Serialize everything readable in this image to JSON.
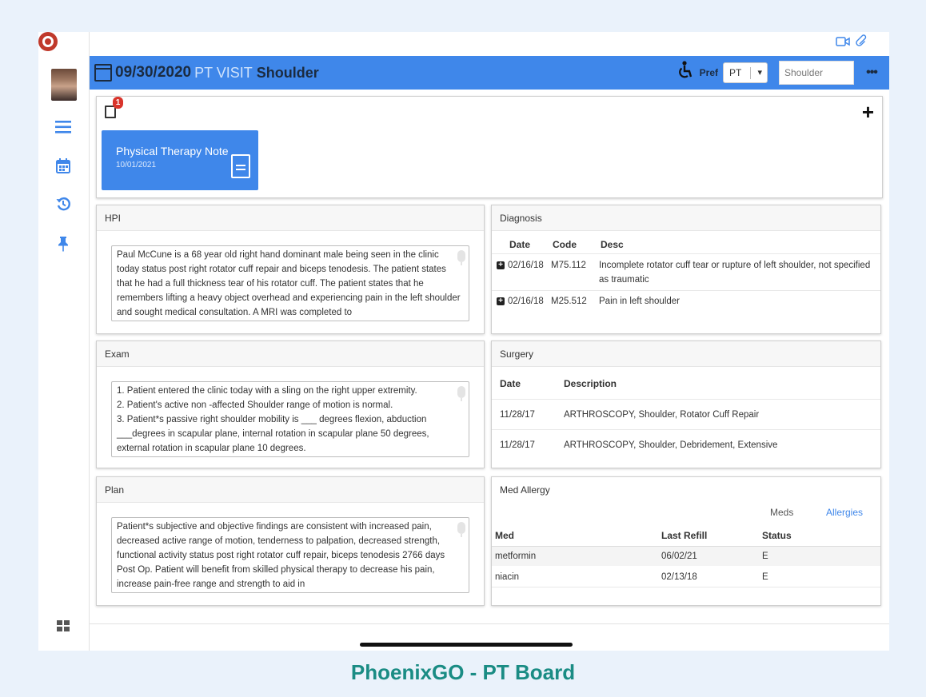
{
  "header": {
    "date": "09/30/2020",
    "visit": "PT VISIT",
    "region": "Shoulder",
    "pref_label": "Pref",
    "pref_value": "PT",
    "region_field": "Shoulder",
    "more": "•••",
    "accent": "#3f87ea"
  },
  "rail": {
    "icons": [
      "logo-icon",
      "avatar",
      "menu-icon",
      "calendar-icon",
      "history-icon",
      "pin-icon",
      "apps-grid-icon"
    ]
  },
  "notes": {
    "badge_count": "1",
    "add": "+",
    "card_title": "Physical Therapy Note",
    "card_date": "10/01/2021"
  },
  "hpi": {
    "title": "HPI",
    "text": "Paul McCune is a 68 year old  right hand dominant male being seen in the clinic today status post right rotator cuff repair and biceps tenodesis. The patient states that he had a full thickness tear of his rotator cuff. The patient states that he remembers lifting a heavy object overhead and experiencing pain in the left shoulder and sought medical consultation. A MRI was completed to"
  },
  "exam": {
    "title": "Exam",
    "lines": [
      "1.    Patient entered the clinic today with a sling on the right upper extremity.",
      "2.    Patient's active non -affected Shoulder range of motion is normal.",
      "3.    Patient*s passive right shoulder mobility is ___ degrees flexion, abduction",
      "___degrees in scapular plane, internal rotation in scapular plane 50 degrees,",
      "external rotation in scapular plane 10 degrees."
    ]
  },
  "plan": {
    "title": "Plan",
    "text": "Patient*s subjective and objective findings are consistent with increased pain, decreased active range of motion, tenderness to palpation, decreased strength, functional activity status post right rotator cuff repair, biceps tenodesis 2766 days Post Op. Patient will benefit from skilled physical therapy to decrease his pain, increase pain-free range and strength to aid in"
  },
  "diagnosis": {
    "title": "Diagnosis",
    "headers": [
      "Date",
      "Code",
      "Desc"
    ],
    "rows": [
      {
        "date": "02/16/18",
        "code": "M75.112",
        "desc": "Incomplete rotator cuff tear or rupture of left shoulder, not specified as traumatic"
      },
      {
        "date": "02/16/18",
        "code": "M25.512",
        "desc": "Pain in left shoulder"
      }
    ]
  },
  "surgery": {
    "title": "Surgery",
    "headers": [
      "Date",
      "Description"
    ],
    "rows": [
      {
        "date": "11/28/17",
        "desc": "ARTHROSCOPY, Shoulder, Rotator Cuff Repair"
      },
      {
        "date": "11/28/17",
        "desc": "ARTHROSCOPY, Shoulder, Debridement, Extensive"
      }
    ]
  },
  "med_allergy": {
    "title": "Med Allergy",
    "tabs": [
      "Meds",
      "Allergies"
    ],
    "headers": [
      "Med",
      "Last Refill",
      "Status"
    ],
    "rows": [
      {
        "med": "metformin",
        "refill": "06/02/21",
        "status": "E"
      },
      {
        "med": "niacin",
        "refill": "02/13/18",
        "status": "E"
      }
    ]
  },
  "caption": "PhoenixGO - PT Board"
}
